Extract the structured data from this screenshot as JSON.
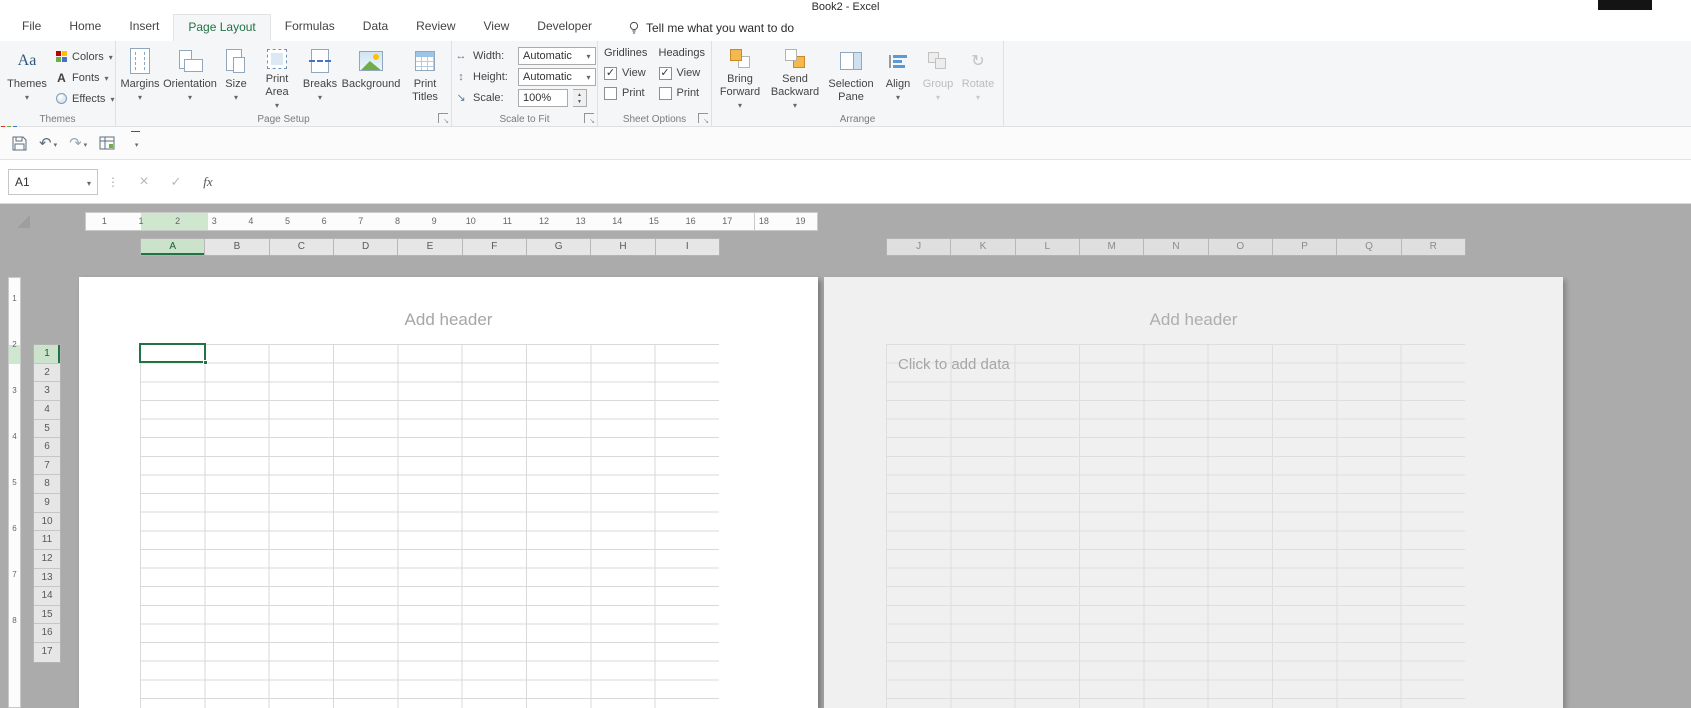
{
  "titlebar": {
    "title": "Book2 - Excel"
  },
  "ribbon_tabs": [
    {
      "label": "File"
    },
    {
      "label": "Home"
    },
    {
      "label": "Insert"
    },
    {
      "label": "Page Layout"
    },
    {
      "label": "Formulas"
    },
    {
      "label": "Data"
    },
    {
      "label": "Review"
    },
    {
      "label": "View"
    },
    {
      "label": "Developer"
    }
  ],
  "tell_me": "Tell me what you want to do",
  "icons": {
    "themes_glyph": "Aa",
    "fonts_glyph": "A"
  },
  "themes_group": {
    "group_label": "Themes",
    "themes": "Themes",
    "colors": "Colors",
    "fonts": "Fonts",
    "effects": "Effects"
  },
  "page_setup_group": {
    "group_label": "Page Setup",
    "margins": "Margins",
    "orientation": "Orientation",
    "size": "Size",
    "print_area": "Print Area",
    "breaks": "Breaks",
    "background": "Background",
    "print_titles": "Print Titles"
  },
  "scale_group": {
    "group_label": "Scale to Fit",
    "width_label": "Width:",
    "width_value": "Automatic",
    "height_label": "Height:",
    "height_value": "Automatic",
    "scale_label": "Scale:",
    "scale_value": "100%"
  },
  "sheet_options_group": {
    "group_label": "Sheet Options",
    "gridlines_label": "Gridlines",
    "headings_label": "Headings",
    "view_label": "View",
    "print_label": "Print",
    "checks": {
      "gridlines_view": "✓",
      "gridlines_print": "",
      "headings_view": "✓",
      "headings_print": ""
    }
  },
  "arrange_group": {
    "group_label": "Arrange",
    "bring_forward": "Bring Forward",
    "send_backward": "Send Backward",
    "selection_pane": "Selection Pane",
    "align": "Align",
    "group": "Group",
    "rotate": "Rotate"
  },
  "formula_bar": {
    "name_box": "A1",
    "fx_label": "fx",
    "formula_value": ""
  },
  "ruler_h": [
    "1",
    "1",
    "2",
    "3",
    "4",
    "5",
    "6",
    "7",
    "8",
    "9",
    "10",
    "11",
    "12",
    "13",
    "14",
    "15",
    "16",
    "17",
    "18",
    "19"
  ],
  "ruler_v": [
    "1",
    "2",
    "3",
    "4",
    "5",
    "6",
    "7",
    "8"
  ],
  "columns_page1": [
    "A",
    "B",
    "C",
    "D",
    "E",
    "F",
    "G",
    "H",
    "I"
  ],
  "columns_page2": [
    "J",
    "K",
    "L",
    "M",
    "N",
    "O",
    "P",
    "Q",
    "R"
  ],
  "row_numbers": [
    "1",
    "2",
    "3",
    "4",
    "5",
    "6",
    "7",
    "8",
    "9",
    "10",
    "11",
    "12",
    "13",
    "14",
    "15",
    "16",
    "17"
  ],
  "page1": {
    "header_placeholder": "Add header"
  },
  "page2": {
    "header_placeholder": "Add header",
    "data_placeholder": "Click to add data"
  },
  "colors": {
    "accent": "#217346",
    "selection_highlight": "#cfe7cf"
  }
}
